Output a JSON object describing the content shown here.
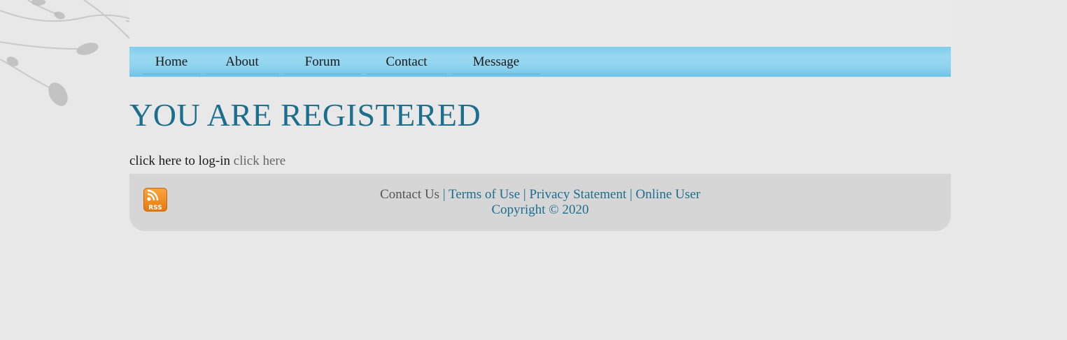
{
  "nav": {
    "items": [
      {
        "label": "Home"
      },
      {
        "label": "About"
      },
      {
        "label": "Forum"
      },
      {
        "label": "Contact"
      },
      {
        "label": "Message"
      }
    ]
  },
  "main": {
    "title": "YOU ARE REGISTERED",
    "login_text": "click here to log-in",
    "login_link": "click here"
  },
  "footer": {
    "rss_icon": "rss-feed-icon",
    "links": {
      "contact_us": "Contact Us",
      "terms": "Terms of Use",
      "privacy": "Privacy Statement",
      "online_user": "Online User"
    },
    "separator": "|",
    "copyright": "Copyright © 2020"
  },
  "colors": {
    "accent": "#1b6e8e",
    "nav_blue": "#8cd2ee",
    "background": "#e8e8e8",
    "footer_bg": "#d6d6d6",
    "rss_orange": "#f28a1c"
  }
}
